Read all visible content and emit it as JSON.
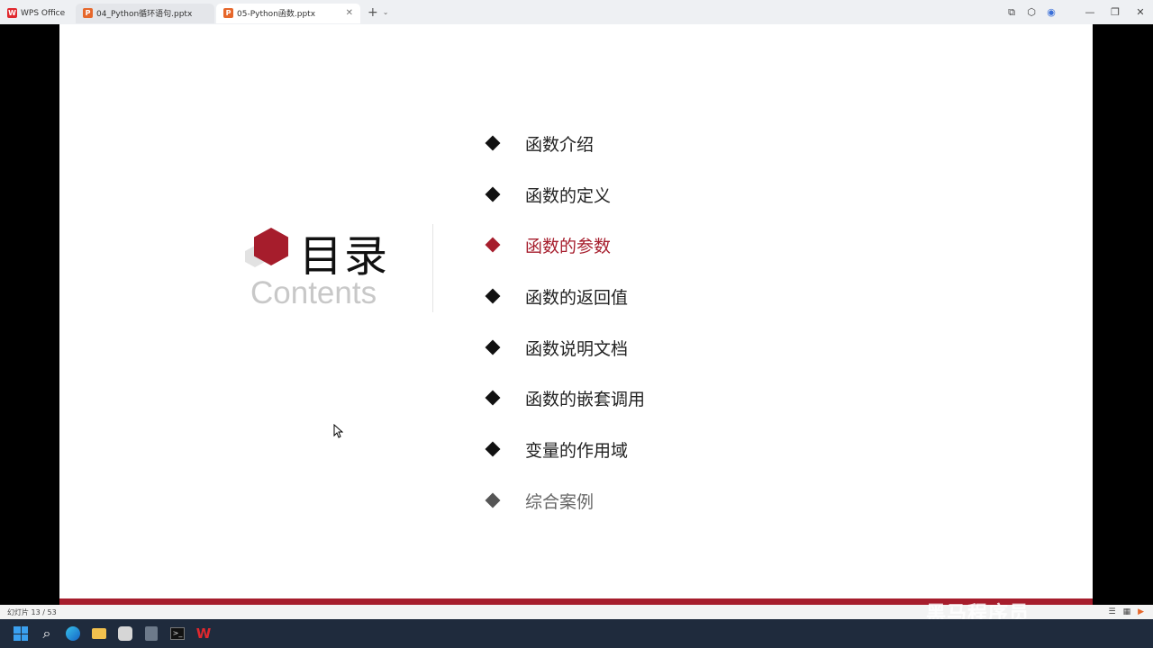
{
  "tabs": {
    "home": "WPS Office",
    "tab1": "04_Python循环语句.pptx",
    "tab2": "05-Python函数.pptx"
  },
  "icons": {
    "new_tab": "+",
    "chevron": "⌄",
    "close": "✕",
    "win_restore": "⧉",
    "win_min": "—",
    "win_max": "❐",
    "win_close": "✕"
  },
  "slide": {
    "title_cn": "目录",
    "title_en": "Contents",
    "items": [
      {
        "label": "函数介绍"
      },
      {
        "label": "函数的定义"
      },
      {
        "label": "函数的参数"
      },
      {
        "label": "函数的返回值"
      },
      {
        "label": "函数说明文档"
      },
      {
        "label": "函数的嵌套调用"
      },
      {
        "label": "变量的作用域"
      },
      {
        "label": "综合案例"
      }
    ],
    "active_index": 2,
    "accent": "#a61d2c"
  },
  "status": {
    "slide_counter": "幻灯片 13 / 53",
    "watermark": "黑马程序员"
  }
}
